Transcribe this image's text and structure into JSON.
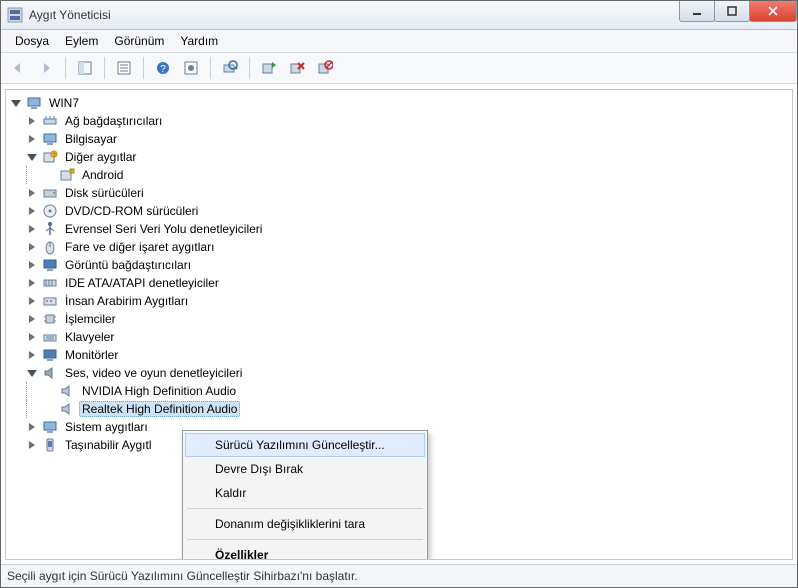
{
  "window": {
    "title": "Aygıt Yöneticisi"
  },
  "menu": {
    "file": "Dosya",
    "action": "Eylem",
    "view": "Görünüm",
    "help": "Yardım"
  },
  "tree": {
    "root": "WIN7",
    "items": {
      "network_adapters": "Ağ bağdaştırıcıları",
      "computer": "Bilgisayar",
      "other_devices": "Diğer aygıtlar",
      "android": "Android",
      "disk_drives": "Disk sürücüleri",
      "dvd_cdrom": "DVD/CD-ROM sürücüleri",
      "usb_controllers": "Evrensel Seri Veri Yolu denetleyicileri",
      "mice": "Fare ve diğer işaret aygıtları",
      "display_adapters": "Görüntü bağdaştırıcıları",
      "ide_atapi": "IDE ATA/ATAPI denetleyiciler",
      "hid": "İnsan Arabirim Aygıtları",
      "processors": "İşlemciler",
      "keyboards": "Klavyeler",
      "monitors": "Monitörler",
      "sound_video_game": "Ses, video ve oyun denetleyicileri",
      "nvidia_hd_audio": "NVIDIA High Definition Audio",
      "realtek_hd_audio": "Realtek High Definition Audio",
      "system_devices": "Sistem aygıtları",
      "portable_devices": "Taşınabilir Aygıtl"
    }
  },
  "context_menu": {
    "update_driver": "Sürücü Yazılımını Güncelleştir...",
    "disable": "Devre Dışı Bırak",
    "uninstall": "Kaldır",
    "scan_hw": "Donanım değişikliklerini tara",
    "properties": "Özellikler"
  },
  "status": {
    "text": "Seçili aygıt için Sürücü Yazılımını Güncelleştir Sihirbazı'nı başlatır."
  },
  "colors": {
    "close_btn": "#d84531",
    "selection": "#cde4f7"
  }
}
